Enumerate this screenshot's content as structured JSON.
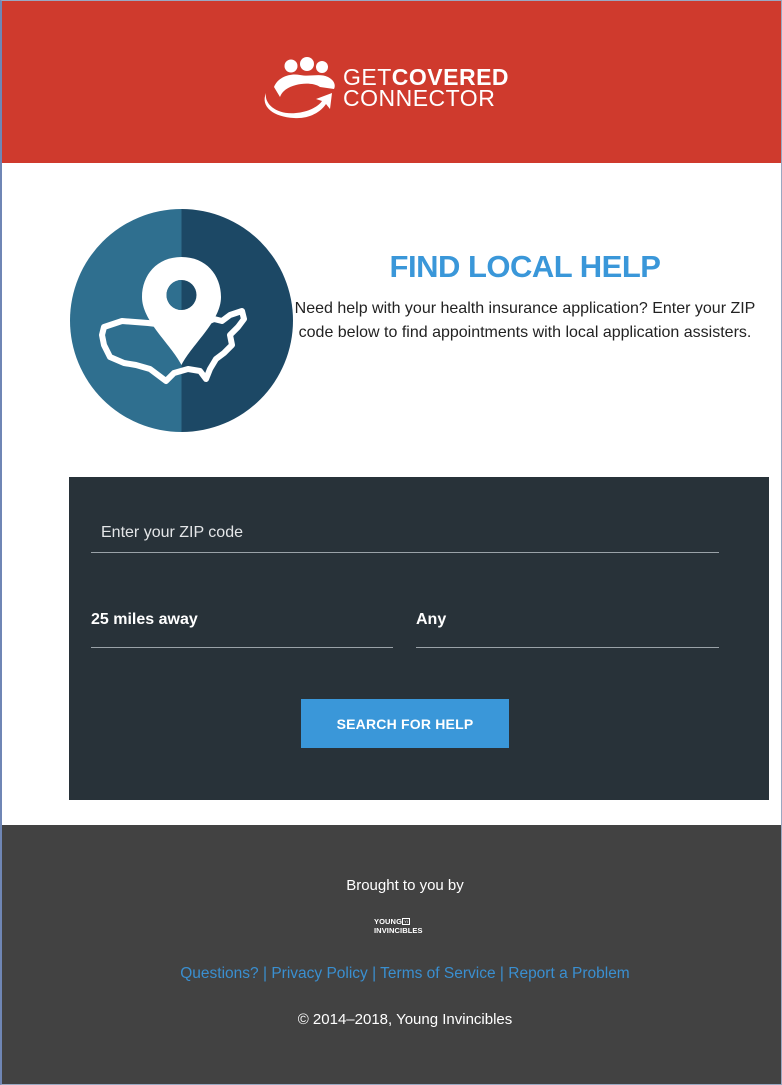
{
  "header": {
    "logo_line1_thin": "GET",
    "logo_line1_bold": "COVERED",
    "logo_line2": "CONNECTOR",
    "background_color": "#cf3a2d"
  },
  "hero": {
    "icon": "map-pin-usa-icon",
    "title": "FIND LOCAL HELP",
    "description": "Need help with your health insurance application? Enter your ZIP code below to find appointments with local application assisters.",
    "title_color": "#3a97d9"
  },
  "search": {
    "zip_placeholder": "Enter your ZIP code",
    "zip_value": "",
    "distance_selected": "25 miles away",
    "type_selected": "Any",
    "button_label": "SEARCH FOR HELP",
    "panel_color": "#283239",
    "button_color": "#3a97d9"
  },
  "footer": {
    "brought_by": "Brought to you by",
    "sponsor_logo_line1": "YOUNG",
    "sponsor_logo_badge": "YI",
    "sponsor_logo_line2": "INVINCIBLES",
    "links": [
      "Questions?",
      "Privacy Policy",
      "Terms of Service",
      "Report a Problem"
    ],
    "separator": "|",
    "copyright": "© 2014–2018, Young Invincibles",
    "background_color": "#424242",
    "link_color": "#3a8fd0"
  }
}
